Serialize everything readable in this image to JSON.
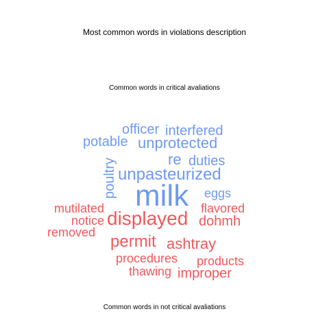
{
  "titles": {
    "main": "Most common words in violations description",
    "critical": "Common words in critical avaliations",
    "not_critical": "Common words in not critical avaliations"
  },
  "colors": {
    "critical": "#6E99F2",
    "not_critical": "#F0585C"
  },
  "words": [
    {
      "text": "officer",
      "group": "critical"
    },
    {
      "text": "interfered",
      "group": "critical"
    },
    {
      "text": "potable",
      "group": "critical"
    },
    {
      "text": "unprotected",
      "group": "critical"
    },
    {
      "text": "re",
      "group": "critical"
    },
    {
      "text": "duties",
      "group": "critical"
    },
    {
      "text": "poultry",
      "group": "critical"
    },
    {
      "text": "unpasteurized",
      "group": "critical"
    },
    {
      "text": "eggs",
      "group": "critical"
    },
    {
      "text": "milk",
      "group": "critical"
    },
    {
      "text": "mutilated",
      "group": "not_critical"
    },
    {
      "text": "flavored",
      "group": "not_critical"
    },
    {
      "text": "notice",
      "group": "not_critical"
    },
    {
      "text": "displayed",
      "group": "not_critical"
    },
    {
      "text": "dohmh",
      "group": "not_critical"
    },
    {
      "text": "removed",
      "group": "not_critical"
    },
    {
      "text": "permit",
      "group": "not_critical"
    },
    {
      "text": "ashtray",
      "group": "not_critical"
    },
    {
      "text": "procedures",
      "group": "not_critical"
    },
    {
      "text": "products",
      "group": "not_critical"
    },
    {
      "text": "thawing",
      "group": "not_critical"
    },
    {
      "text": "improper",
      "group": "not_critical"
    }
  ]
}
